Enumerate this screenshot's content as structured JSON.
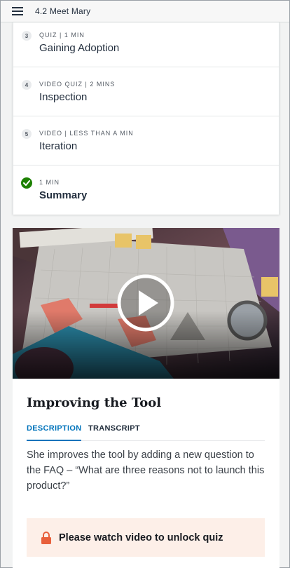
{
  "header": {
    "title": "4.2 Meet Mary",
    "menu_icon": "hamburger-icon"
  },
  "lessons": [
    {
      "number": "3",
      "meta": "QUIZ | 1 MIN",
      "title": "Gaining Adoption",
      "completed": false
    },
    {
      "number": "4",
      "meta": "VIDEO QUIZ | 2 MINS",
      "title": "Inspection",
      "completed": false
    },
    {
      "number": "5",
      "meta": "VIDEO | LESS THAN A MIN",
      "title": "Iteration",
      "completed": false
    },
    {
      "number": "",
      "meta": "1 MIN",
      "title": "Summary",
      "completed": true
    }
  ],
  "video": {
    "title": "Improving the Tool",
    "play_icon": "play-icon",
    "tabs": [
      {
        "label": "DESCRIPTION",
        "active": true
      },
      {
        "label": "TRANSCRIPT",
        "active": false
      }
    ],
    "description": "She improves the tool by adding a new question to the FAQ – “What are three reasons not to launch this product?”"
  },
  "quiz_lock": {
    "label": "Please watch video to unlock quiz",
    "icon": "lock-icon"
  },
  "colors": {
    "accent": "#0073bb",
    "success": "#1d8102",
    "lock": "#e8603c",
    "lock_bg": "#fdefe8"
  }
}
